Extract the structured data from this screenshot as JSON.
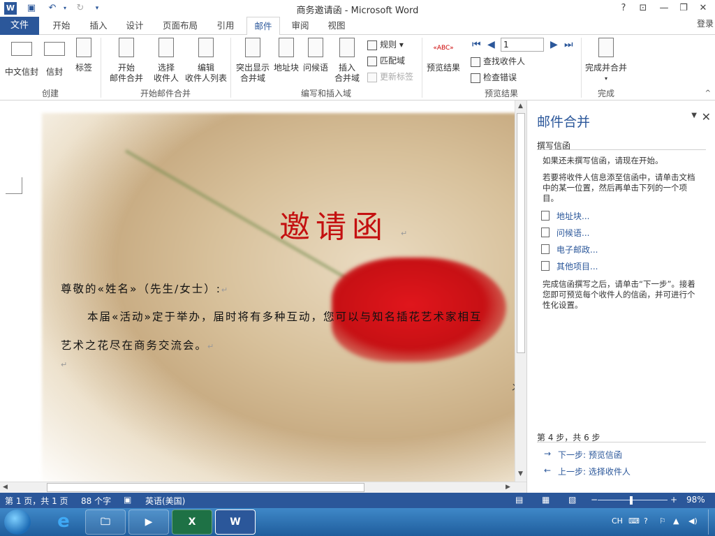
{
  "window": {
    "title": "商务邀请函 - Microsoft Word",
    "qat": {
      "word_icon": "W",
      "save_icon": "save-icon",
      "undo_icon": "undo-icon",
      "redo_icon": "redo-icon",
      "customize_icon": "qat-customize-icon"
    },
    "controls": {
      "help": "?",
      "ribbon_display": "⊡",
      "minimize": "—",
      "restore": "❐",
      "close": "✕"
    }
  },
  "tabs": {
    "file": "文件",
    "items": [
      "开始",
      "插入",
      "设计",
      "页面布局",
      "引用",
      "邮件",
      "审阅",
      "视图"
    ],
    "active": "邮件",
    "login": "登录"
  },
  "ribbon": {
    "groups": {
      "create": "创建",
      "start_merge": "开始邮件合并",
      "write_insert": "编写和插入域",
      "preview": "预览结果",
      "finish": "完成"
    },
    "buttons": {
      "chinese_envelope": "中文信封",
      "envelope": "信封",
      "labels": "标签",
      "start_merge_l1": "开始",
      "start_merge_l2": "邮件合并",
      "select_recipients_l1": "选择",
      "select_recipients_l2": "收件人",
      "edit_list_l1": "编辑",
      "edit_list_l2": "收件人列表",
      "highlight_l1": "突出显示",
      "highlight_l2": "合并域",
      "address_block": "地址块",
      "greeting_line": "问候语",
      "insert_field_l1": "插入",
      "insert_field_l2": "合并域",
      "rules": "规则",
      "match_fields": "匹配域",
      "update_labels": "更新标签",
      "preview_results": "预览结果",
      "record_number": "1",
      "find_recipient": "查找收件人",
      "check_errors": "检查错误",
      "finish_merge": "完成并合并"
    }
  },
  "document": {
    "title": "邀请函",
    "line1": "尊敬的«姓名»（先生/女士）:",
    "line2": "本届«活动»定于举办，届时将有多种互动，您可以与知名插花艺术家相互",
    "line3": "艺术之花尽在商务交流会。",
    "para_mark": "↵",
    "cut_char": "ㄨ"
  },
  "task_pane": {
    "title": "邮件合并",
    "section": "撰写信函",
    "p1": "如果还未撰写信函，请现在开始。",
    "p2": "若要将收件人信息添至信函中，请单击文档中的某一位置，然后再单击下列的一个项目。",
    "links": [
      "地址块...",
      "问候语...",
      "电子邮政...",
      "其他项目..."
    ],
    "p3": "完成信函撰写之后，请单击“下一步”。接着您即可预览每个收件人的信函，并可进行个性化设置。",
    "step": "第 4 步，共 6 步",
    "next": "下一步: 预览信函",
    "prev": "上一步: 选择收件人"
  },
  "status": {
    "page": "第 1 页，共 1 页",
    "words": "88 个字",
    "lang": "英语(美国)",
    "zoom": "98%"
  },
  "taskbar": {
    "apps": [
      "ie-icon",
      "explorer-icon",
      "media-icon",
      "excel-icon",
      "word-icon"
    ],
    "tray_lang": "CH"
  }
}
